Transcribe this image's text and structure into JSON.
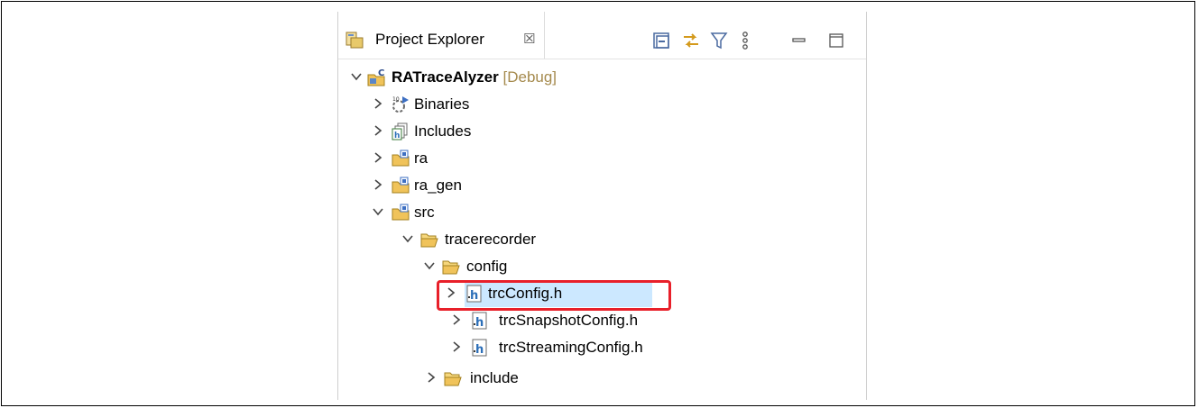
{
  "explorer": {
    "tab_label": "Project Explorer",
    "close_glyph": "☒",
    "toolbar": [
      "collapse-all-icon",
      "link-with-editor-icon",
      "filter-icon",
      "view-menu-icon",
      "minimize-icon",
      "maximize-icon"
    ]
  },
  "tree": {
    "project": {
      "name": "RATraceAlyzer",
      "config": "[Debug]"
    },
    "binaries": "Binaries",
    "includes": "Includes",
    "ra": "ra",
    "ra_gen": "ra_gen",
    "src": "src",
    "tracerecorder": "tracerecorder",
    "config": "config",
    "trcConfig": "trcConfig.h",
    "trcSnapshotConfig": "trcSnapshotConfig.h",
    "trcStreamingConfig": "trcStreamingConfig.h",
    "include": "include"
  },
  "colors": {
    "highlight_box": "#e8202a",
    "selection": "#cce8ff",
    "debug_label": "#a58a4d"
  }
}
